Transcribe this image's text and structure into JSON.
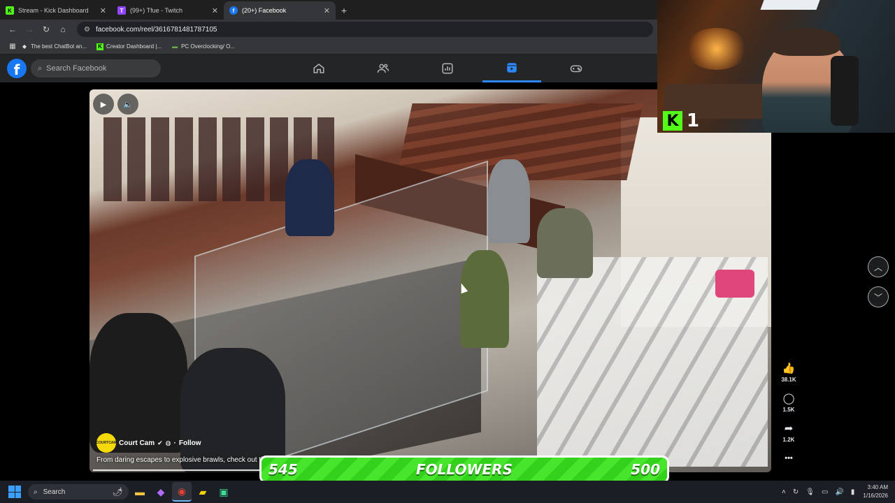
{
  "browser": {
    "tabs": [
      {
        "title": "Stream - Kick Dashboard",
        "icon": "K",
        "icon_color": "#53fc18",
        "active": false
      },
      {
        "title": "(99+) Tfue - Twitch",
        "icon": "T",
        "icon_color": "#9146ff",
        "active": false
      },
      {
        "title": "(20+) Facebook",
        "icon": "f",
        "icon_color": "#1877f2",
        "active": true
      }
    ],
    "new_tab": "+",
    "url": "facebook.com/reel/3616781481787105",
    "bookmarks": [
      {
        "label": "The best ChatBot an...",
        "icon": "◆"
      },
      {
        "label": "Creator Dashboard |...",
        "icon": "K"
      },
      {
        "label": "PC Overclocking/ O...",
        "icon": "▬"
      }
    ]
  },
  "facebook": {
    "logo": "f",
    "search_placeholder": "Search Facebook",
    "nav": [
      "home-icon",
      "friends-icon",
      "dashboard-icon",
      "reels-icon",
      "gaming-icon"
    ],
    "accent": "#2d88ff"
  },
  "reel": {
    "owner_name": "Court Cam",
    "owner_avatar_text": "COURTCAM",
    "follow_label": "Follow",
    "caption": "From daring escapes to explosive brawls, check out th",
    "likes": "38.1K",
    "comments": "1.5K",
    "shares": "1.2K",
    "more": "•••"
  },
  "webcam": {
    "kick_logo": "K",
    "viewer_count": "1"
  },
  "goal_bar": {
    "current": "545",
    "label": "FOLLOWERS",
    "target": "500",
    "color": "#34d11c"
  },
  "taskbar": {
    "search_label": "Search",
    "time": "3:40 AM",
    "date": "1/16/2026"
  }
}
